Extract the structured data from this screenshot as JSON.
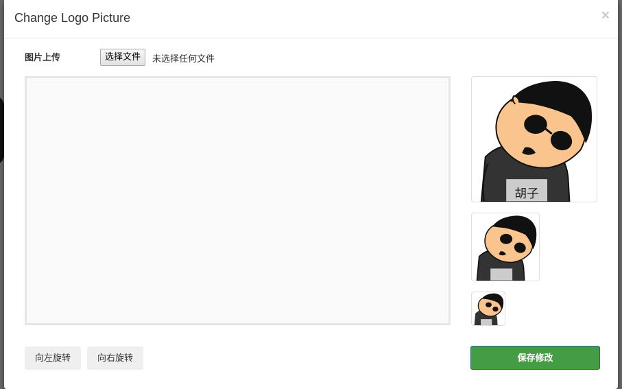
{
  "modal": {
    "title": "Change Logo Picture",
    "close_glyph": "×"
  },
  "upload": {
    "label": "图片上传",
    "choose_file_label": "选择文件",
    "no_file_text": "未选择任何文件"
  },
  "preview": {
    "shirt_text": "胡子"
  },
  "actions": {
    "rotate_left_label": "向左旋转",
    "rotate_right_label": "向右旋转",
    "save_label": "保存修改"
  },
  "colors": {
    "save_button": "#449d44",
    "crop_background": "#fafafa"
  },
  "icons": {
    "close": "close-icon",
    "avatar": "cartoon-avatar-image"
  }
}
